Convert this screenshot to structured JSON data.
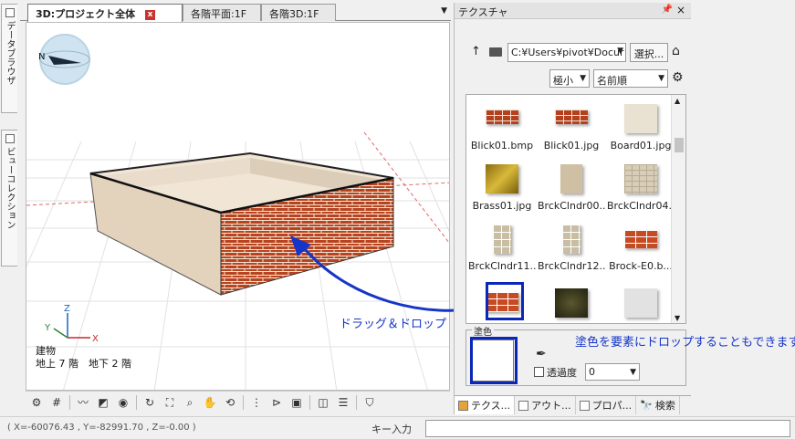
{
  "left_tabs": [
    {
      "label": "データブラウザ"
    },
    {
      "label": "ビューコレクション"
    }
  ],
  "tabs": [
    {
      "label": "3D:プロジェクト全体",
      "active": true
    },
    {
      "label": "各階平面:1F"
    },
    {
      "label": "各階3D:1F"
    }
  ],
  "viewport": {
    "compass_label": "N",
    "axes": {
      "z": "Z",
      "y": "Y",
      "x": "X"
    },
    "info_line1": "建物",
    "info_line2": "地上 7 階　地下 2 階"
  },
  "status": {
    "coords": "( X=-60076.43 , Y=-82991.70 , Z=-0.00 )",
    "key_input_label": "キー入力"
  },
  "panel": {
    "title": "テクスチャ",
    "path": "C:¥Users¥pivot¥Docur",
    "select_button": "選択...",
    "size_option": "極小",
    "sort_option": "名前順",
    "textures": [
      {
        "name": "Blick01.bmp"
      },
      {
        "name": "Blick01.jpg"
      },
      {
        "name": "Board01.jpg"
      },
      {
        "name": "Brass01.jpg"
      },
      {
        "name": "BrckClndr00..."
      },
      {
        "name": "BrckClndr04..."
      },
      {
        "name": "BrckClndr11..."
      },
      {
        "name": "BrckClndr12..."
      },
      {
        "name": "Brock-E0.b..."
      },
      {
        "name": ""
      },
      {
        "name": ""
      },
      {
        "name": ""
      }
    ],
    "paint_group_label": "塗色",
    "transparency_label": "透過度",
    "transparency_value": "0",
    "bottom_tabs": [
      {
        "label": "テクス..."
      },
      {
        "label": "アウト..."
      },
      {
        "label": "プロパ..."
      },
      {
        "label": "検索"
      }
    ]
  },
  "annotations": {
    "drag_drop": "ドラッグ＆ドロップ",
    "drop_paint": "塗色を要素にドロップすることもできます"
  },
  "colors": {
    "annotation_blue": "#1535c8",
    "selection_blue": "#0b27b8",
    "brick": "#b4401e"
  }
}
